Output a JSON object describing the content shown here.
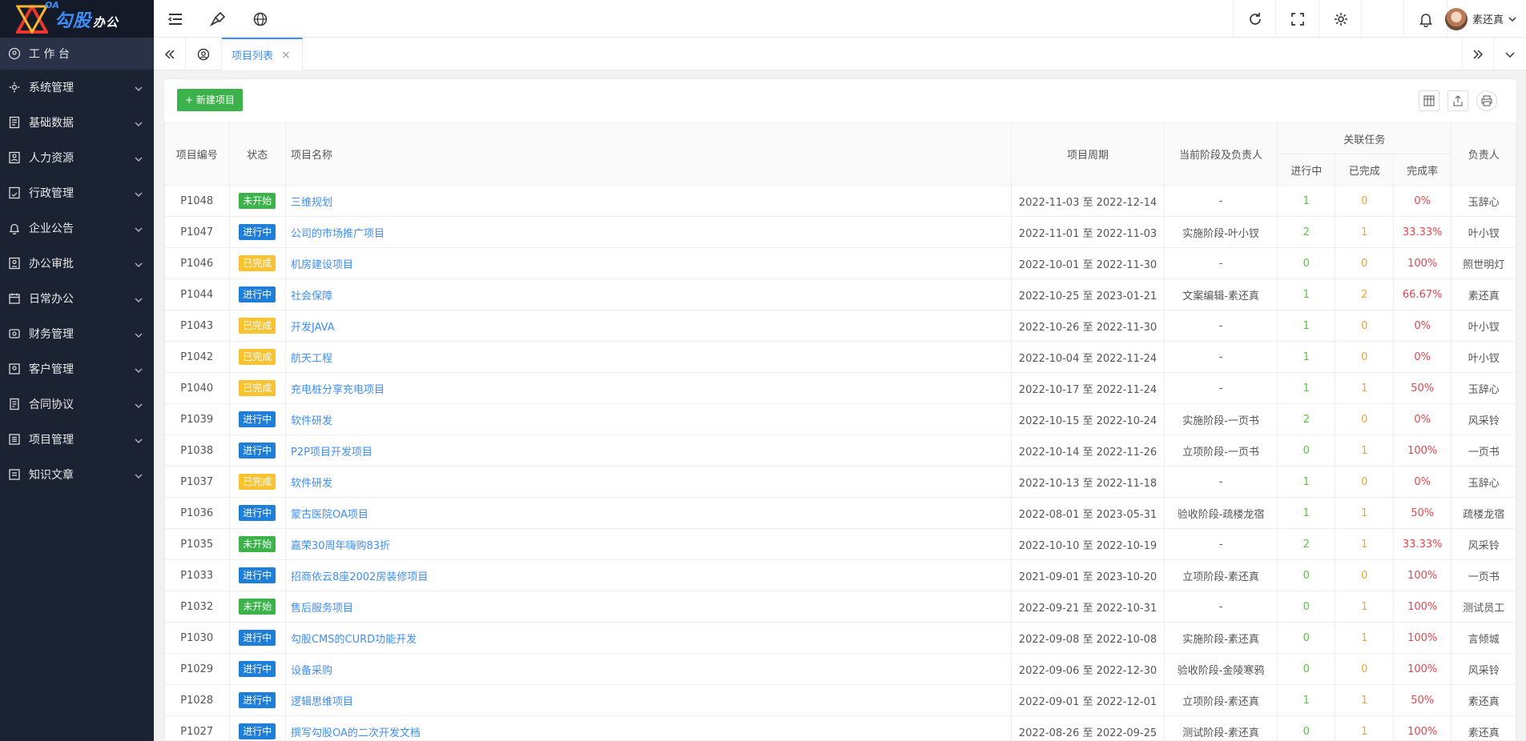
{
  "app": {
    "logo_oa": "OA",
    "logo_brand": "勾股",
    "logo_suffix": "办公"
  },
  "sidebar": {
    "items": [
      {
        "label": "工 作 台",
        "icon": "dashboard-icon"
      },
      {
        "label": "系统管理",
        "icon": "settings-icon"
      },
      {
        "label": "基础数据",
        "icon": "database-icon"
      },
      {
        "label": "人力资源",
        "icon": "person-icon"
      },
      {
        "label": "行政管理",
        "icon": "admin-icon"
      },
      {
        "label": "企业公告",
        "icon": "bell-icon"
      },
      {
        "label": "办公审批",
        "icon": "approval-icon"
      },
      {
        "label": "日常办公",
        "icon": "calendar-icon"
      },
      {
        "label": "财务管理",
        "icon": "finance-icon"
      },
      {
        "label": "客户管理",
        "icon": "customer-icon"
      },
      {
        "label": "合同协议",
        "icon": "contract-icon"
      },
      {
        "label": "项目管理",
        "icon": "project-icon"
      },
      {
        "label": "知识文章",
        "icon": "article-icon"
      }
    ]
  },
  "header": {
    "user_name": "素还真"
  },
  "tabs": {
    "active_label": "项目列表",
    "close": "×"
  },
  "toolbar": {
    "new_label": "+ 新建项目"
  },
  "table": {
    "headers": {
      "code": "项目编号",
      "status": "状态",
      "name": "项目名称",
      "period": "项目周期",
      "stage": "当前阶段及负责人",
      "tasks_group": "关联任务",
      "in_progress": "进行中",
      "done": "已完成",
      "rate": "完成率",
      "owner": "负责人"
    },
    "rows": [
      {
        "code": "P1048",
        "status": "未开始",
        "status_color": "#3cb34a",
        "name": "三维规划",
        "period": "2022-11-03 至 2022-12-14",
        "stage": "-",
        "in_progress": "1",
        "done": "0",
        "rate": "0%",
        "owner": "玉辞心"
      },
      {
        "code": "P1047",
        "status": "进行中",
        "status_color": "#1e7ed8",
        "name": "公司的市场推广项目",
        "period": "2022-11-01 至 2022-11-03",
        "stage": "实施阶段-叶小钗",
        "in_progress": "2",
        "done": "1",
        "rate": "33.33%",
        "owner": "叶小钗"
      },
      {
        "code": "P1046",
        "status": "已完成",
        "status_color": "#f8c230",
        "name": "机房建设项目",
        "period": "2022-10-01 至 2022-11-30",
        "stage": "-",
        "in_progress": "0",
        "done": "0",
        "rate": "100%",
        "owner": "照世明灯"
      },
      {
        "code": "P1044",
        "status": "进行中",
        "status_color": "#1e7ed8",
        "name": "社会保障",
        "period": "2022-10-25 至 2023-01-21",
        "stage": "文案编辑-素还真",
        "in_progress": "1",
        "done": "2",
        "rate": "66.67%",
        "owner": "素还真"
      },
      {
        "code": "P1043",
        "status": "已完成",
        "status_color": "#f8c230",
        "name": " 开发JAVA",
        "period": "2022-10-26 至 2022-11-30",
        "stage": "-",
        "in_progress": "1",
        "done": "0",
        "rate": "0%",
        "owner": "叶小钗"
      },
      {
        "code": "P1042",
        "status": "已完成",
        "status_color": "#f8c230",
        "name": "航天工程",
        "period": "2022-10-04 至 2022-11-24",
        "stage": "-",
        "in_progress": "1",
        "done": "0",
        "rate": "0%",
        "owner": "叶小钗"
      },
      {
        "code": "P1040",
        "status": "已完成",
        "status_color": "#f8c230",
        "name": "充电桩分享充电项目",
        "period": "2022-10-17 至 2022-11-24",
        "stage": "-",
        "in_progress": "1",
        "done": "1",
        "rate": "50%",
        "owner": "玉辞心"
      },
      {
        "code": "P1039",
        "status": "进行中",
        "status_color": "#1e7ed8",
        "name": "软件研发",
        "period": "2022-10-15 至 2022-10-24",
        "stage": "实施阶段-一页书",
        "in_progress": "2",
        "done": "0",
        "rate": "0%",
        "owner": "风采铃"
      },
      {
        "code": "P1038",
        "status": "进行中",
        "status_color": "#1e7ed8",
        "name": "P2P项目开发项目",
        "period": "2022-10-14 至 2022-11-26",
        "stage": "立项阶段-一页书",
        "in_progress": "0",
        "done": "1",
        "rate": "100%",
        "owner": "一页书"
      },
      {
        "code": "P1037",
        "status": "已完成",
        "status_color": "#f8c230",
        "name": "软件研发",
        "period": "2022-10-13 至 2022-11-18",
        "stage": "-",
        "in_progress": "1",
        "done": "0",
        "rate": "0%",
        "owner": "玉辞心"
      },
      {
        "code": "P1036",
        "status": "进行中",
        "status_color": "#1e7ed8",
        "name": "蒙古医院OA项目",
        "period": "2022-08-01 至 2023-05-31",
        "stage": "验收阶段-疏楼龙宿",
        "in_progress": "1",
        "done": "1",
        "rate": "50%",
        "owner": "疏楼龙宿"
      },
      {
        "code": "P1035",
        "status": "未开始",
        "status_color": "#3cb34a",
        "name": "嘉荣30周年嗨购83折",
        "period": "2022-10-10 至 2022-10-19",
        "stage": "-",
        "in_progress": "2",
        "done": "1",
        "rate": "33.33%",
        "owner": "风采铃"
      },
      {
        "code": "P1033",
        "status": "进行中",
        "status_color": "#1e7ed8",
        "name": "招商依云8座2002房装修项目",
        "period": "2021-09-01 至 2023-10-20",
        "stage": "立项阶段-素还真",
        "in_progress": "0",
        "done": "0",
        "rate": "100%",
        "owner": "一页书"
      },
      {
        "code": "P1032",
        "status": "未开始",
        "status_color": "#3cb34a",
        "name": "售后服务项目",
        "period": "2022-09-21 至 2022-10-31",
        "stage": "-",
        "in_progress": "0",
        "done": "1",
        "rate": "100%",
        "owner": "测试员工"
      },
      {
        "code": "P1030",
        "status": "进行中",
        "status_color": "#1e7ed8",
        "name": "勾股CMS的CURD功能开发",
        "period": "2022-09-08 至 2022-10-08",
        "stage": "实施阶段-素还真",
        "in_progress": "0",
        "done": "1",
        "rate": "100%",
        "owner": "言倾城"
      },
      {
        "code": "P1029",
        "status": "进行中",
        "status_color": "#1e7ed8",
        "name": "设备采购",
        "period": "2022-09-06 至 2022-12-30",
        "stage": "验收阶段-金陵寒鸦",
        "in_progress": "0",
        "done": "0",
        "rate": "100%",
        "owner": "风采铃"
      },
      {
        "code": "P1028",
        "status": "进行中",
        "status_color": "#1e7ed8",
        "name": "逻辑思维项目",
        "period": "2022-09-01 至 2022-12-01",
        "stage": "立项阶段-素还真",
        "in_progress": "1",
        "done": "1",
        "rate": "50%",
        "owner": "素还真"
      },
      {
        "code": "P1027",
        "status": "进行中",
        "status_color": "#1e7ed8",
        "name": " 撰写勾股OA的二次开发文档",
        "period": "2022-08-26 至 2022-09-25",
        "stage": "测试阶段-素还真",
        "in_progress": "0",
        "done": "1",
        "rate": "100%",
        "owner": "素还真"
      }
    ]
  }
}
